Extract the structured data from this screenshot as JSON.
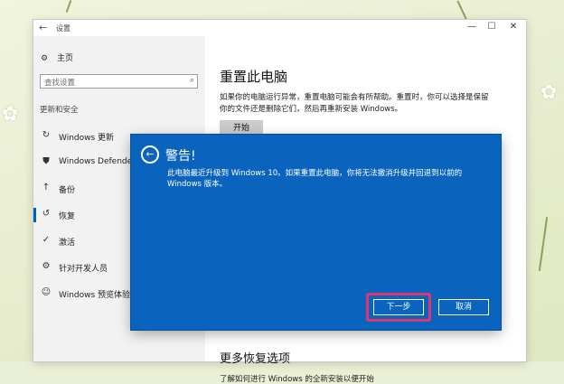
{
  "window": {
    "title": "设置",
    "back_glyph": "←",
    "minimize_glyph": "—",
    "maximize_glyph": "☐",
    "close_glyph": "✕"
  },
  "sidebar": {
    "home_label": "主页",
    "search_placeholder": "查找设置",
    "section_label": "更新和安全",
    "items": [
      {
        "label": "Windows 更新",
        "icon": "refresh-icon",
        "glyph": "↻",
        "active": false
      },
      {
        "label": "Windows Defender",
        "icon": "shield-icon",
        "glyph": "⛊",
        "active": false
      },
      {
        "label": "备份",
        "icon": "backup-icon",
        "glyph": "↑",
        "active": false
      },
      {
        "label": "恢复",
        "icon": "recovery-icon",
        "glyph": "↺",
        "active": true
      },
      {
        "label": "激活",
        "icon": "check-circle-icon",
        "glyph": "✓",
        "active": false
      },
      {
        "label": "针对开发人员",
        "icon": "developer-icon",
        "glyph": "⚙",
        "active": false
      },
      {
        "label": "Windows 预览体验计划",
        "icon": "person-gear-icon",
        "glyph": "☺",
        "active": false
      }
    ]
  },
  "content": {
    "title": "重置此电脑",
    "description": "如果你的电脑运行异常，重置电脑可能会有所帮助。重置时，你可以选择是保留你的文件还是删除它们，然后再重新安装 Windows。",
    "start_label": "开始",
    "more_title": "更多恢复选项",
    "more_desc": "了解如何进行 Windows 的全新安装以便开始"
  },
  "dialog": {
    "title": "警告!",
    "message": "此电脑最近升级到 Windows 10。如果重置此电脑，你将无法撤消升级并回退到以前的 Windows 版本。",
    "next_label": "下一步",
    "cancel_label": "取消"
  },
  "colors": {
    "accent": "#0063b1",
    "dialog_bg": "#0a64be",
    "highlight": "#e0366f"
  }
}
